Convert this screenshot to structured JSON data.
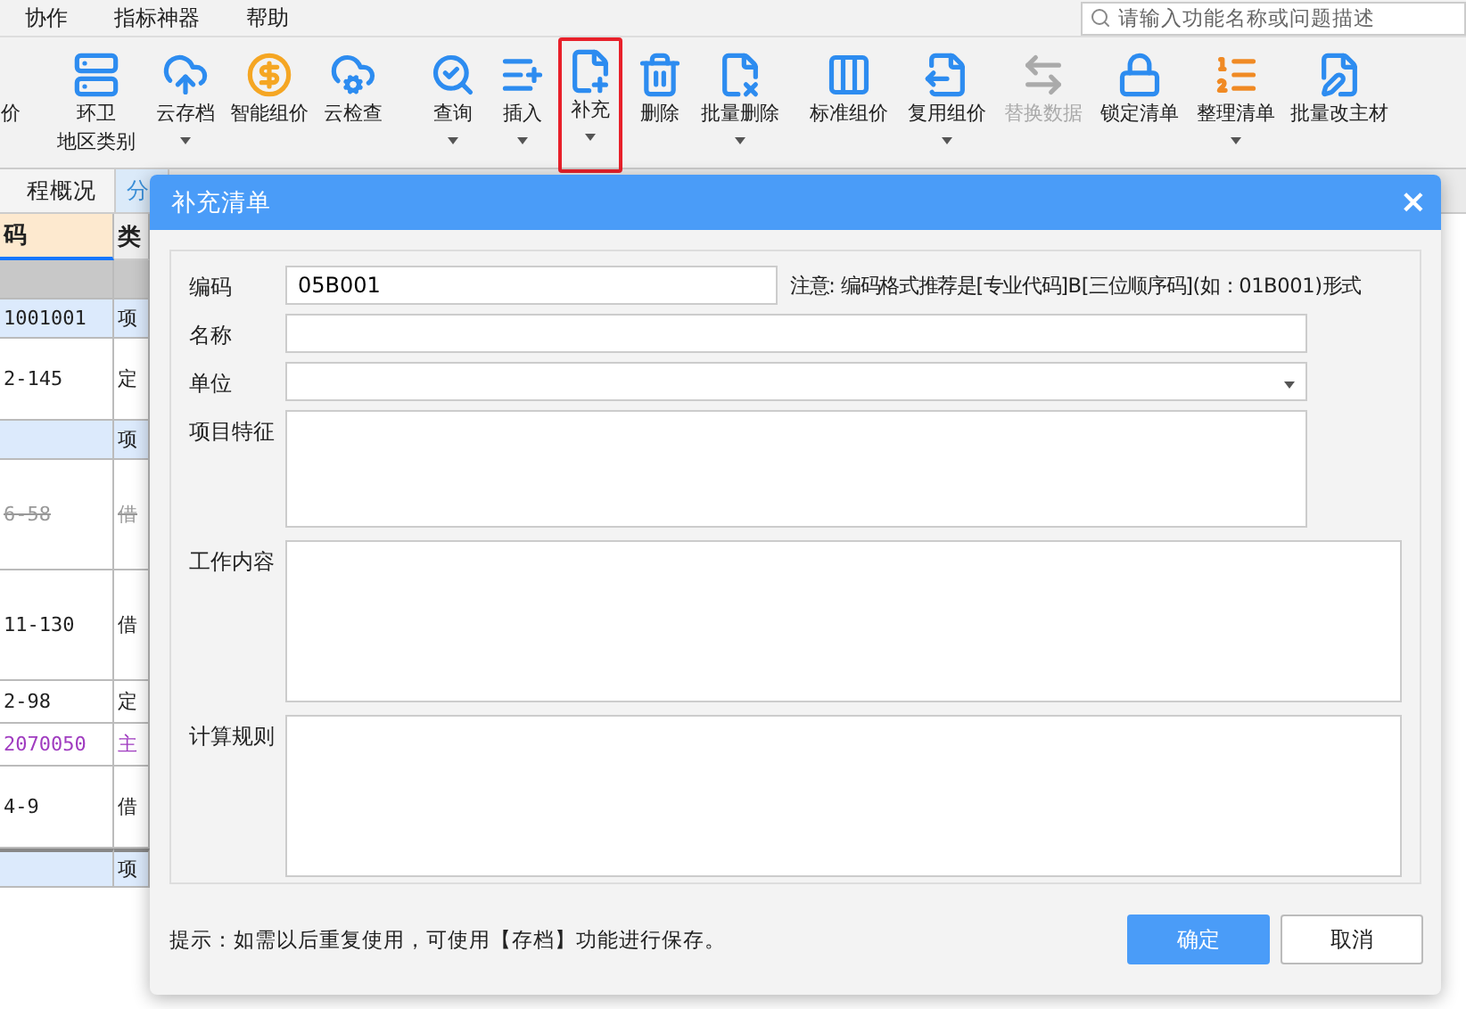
{
  "menu": [
    "协作",
    "指标神器",
    "帮助"
  ],
  "search": {
    "placeholder": "请输入功能名称或问题描述"
  },
  "toolbar": [
    {
      "label": "价",
      "dropdown": false,
      "disabled": false,
      "highlighted": false
    },
    {
      "label": "环卫",
      "sublabel": "地区类别",
      "dropdown": false,
      "disabled": false,
      "highlighted": false
    },
    {
      "label": "云存档",
      "dropdown": true,
      "disabled": false,
      "highlighted": false
    },
    {
      "label": "智能组价",
      "dropdown": false,
      "disabled": false,
      "highlighted": false
    },
    {
      "label": "云检查",
      "dropdown": false,
      "disabled": false,
      "highlighted": false
    },
    {
      "label": "查询",
      "dropdown": true,
      "disabled": false,
      "highlighted": false
    },
    {
      "label": "插入",
      "dropdown": true,
      "disabled": false,
      "highlighted": false
    },
    {
      "label": "补充",
      "dropdown": true,
      "disabled": false,
      "highlighted": true
    },
    {
      "label": "删除",
      "dropdown": false,
      "disabled": false,
      "highlighted": false
    },
    {
      "label": "批量删除",
      "dropdown": true,
      "disabled": false,
      "highlighted": false
    },
    {
      "label": "标准组价",
      "dropdown": false,
      "disabled": false,
      "highlighted": false
    },
    {
      "label": "复用组价",
      "dropdown": true,
      "disabled": false,
      "highlighted": false
    },
    {
      "label": "替换数据",
      "dropdown": false,
      "disabled": true,
      "highlighted": false
    },
    {
      "label": "锁定清单",
      "dropdown": false,
      "disabled": false,
      "highlighted": false
    },
    {
      "label": "整理清单",
      "dropdown": true,
      "disabled": false,
      "highlighted": false
    },
    {
      "label": "批量改主材",
      "dropdown": false,
      "disabled": false,
      "highlighted": false
    }
  ],
  "tabs": [
    {
      "label": "程概况",
      "selected": false
    },
    {
      "label": "分",
      "selected": true
    }
  ],
  "table": {
    "columns": [
      "码",
      "类"
    ],
    "rows": [
      {
        "kind": "group",
        "cells": [
          "",
          ""
        ]
      },
      {
        "kind": "item",
        "cells": [
          "1001001",
          "项"
        ],
        "struck": false,
        "color": "#222222"
      },
      {
        "kind": "tall",
        "cells": [
          "2-145",
          "定"
        ],
        "struck": false,
        "color": "#222222"
      },
      {
        "kind": "item",
        "cells": [
          "",
          "项"
        ],
        "struck": false,
        "color": "#222222"
      },
      {
        "kind": "xtall",
        "cells": [
          "6-58",
          "借"
        ],
        "struck": true,
        "color": "#999999"
      },
      {
        "kind": "xtall",
        "cells": [
          "11-130",
          "借"
        ],
        "struck": false,
        "color": "#222222"
      },
      {
        "kind": "short",
        "cells": [
          "2-98",
          "定"
        ],
        "struck": false,
        "color": "#222222"
      },
      {
        "kind": "short",
        "cells": [
          "2070050",
          "主"
        ],
        "struck": false,
        "color": "#a03cc0"
      },
      {
        "kind": "tall",
        "cells": [
          "4-9",
          "借"
        ],
        "struck": false,
        "color": "#222222"
      },
      {
        "kind": "total",
        "cells": [
          "",
          "项"
        ],
        "struck": false,
        "color": "#222222"
      }
    ]
  },
  "dialog": {
    "title": "补充清单",
    "close": "×",
    "fields": [
      {
        "label": "编码",
        "kind": "input",
        "value": "05B001",
        "note": "注意: 编码格式推荐是[专业代码]B[三位顺序码](如：01B001)形式"
      },
      {
        "label": "名称",
        "kind": "input"
      },
      {
        "label": "单位",
        "kind": "select"
      },
      {
        "label": "项目特征",
        "kind": "shortarea"
      },
      {
        "label": "工作内容",
        "kind": "area"
      },
      {
        "label": "计算规则",
        "kind": "area"
      }
    ],
    "hint": "提示：如需以后重复使用，可使用【存档】功能进行保存。",
    "buttons": [
      {
        "label": "确定",
        "primary": true
      },
      {
        "label": "取消",
        "primary": false
      }
    ]
  }
}
